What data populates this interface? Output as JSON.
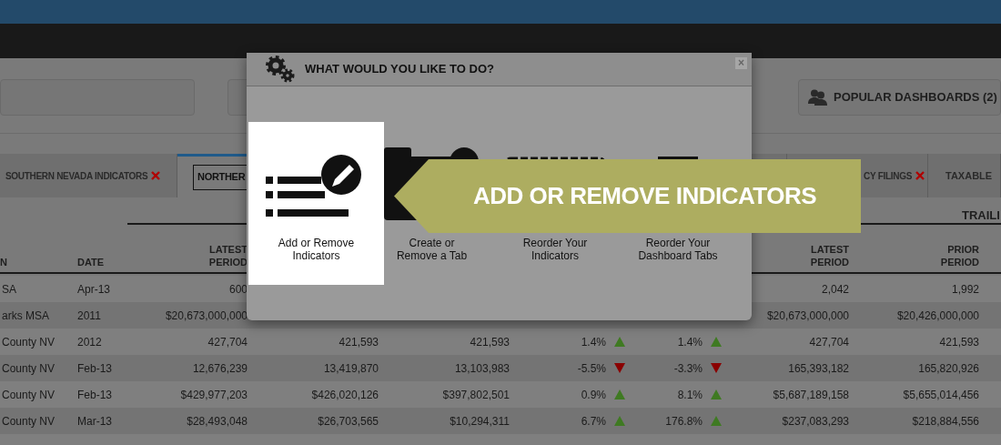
{
  "toolbar": {
    "popular_button": "POPULAR DASHBOARDS (2)"
  },
  "tabs": [
    {
      "label": "SOUTHERN NEVADA INDICATORS",
      "selected": false,
      "closable": true
    },
    {
      "label": "NORTHER",
      "selected": true,
      "closable": false
    },
    {
      "label": "CY FILINGS",
      "selected": false,
      "closable": true
    },
    {
      "label": "TAXABLE",
      "selected": false,
      "closable": false
    }
  ],
  "table": {
    "group_header": "TRAILI",
    "columns": [
      {
        "label": "N"
      },
      {
        "label": "DATE"
      },
      {
        "label": "LATEST\nPERIOD"
      },
      {
        "label": "LATEST\nPERIOD"
      },
      {
        "label": "PRIOR\nPERIOD"
      }
    ],
    "rows": [
      {
        "name": "SA",
        "date": "Apr-13",
        "latest_period": "600",
        "latest_period_2": "2,042",
        "prior_period": "1,992"
      },
      {
        "name": "arks MSA",
        "date": "2011",
        "latest_period": "$20,673,000,000",
        "latest_period_2": "$20,673,000,000",
        "prior_period": "$20,426,000,000"
      },
      {
        "name": "County NV",
        "date": "2012",
        "latest_period": "427,704",
        "column_4": "421,593",
        "column_5": "421,593",
        "change_1": {
          "value": "1.4%",
          "rising": true
        },
        "change_2": {
          "value": "1.4%",
          "rising": true
        },
        "latest_period_2": "427,704",
        "prior_period": "421,593"
      },
      {
        "name": "County NV",
        "date": "Feb-13",
        "latest_period": "12,676,239",
        "column_4": "13,419,870",
        "column_5": "13,103,983",
        "change_1": {
          "value": "-5.5%",
          "rising": false
        },
        "change_2": {
          "value": "-3.3%",
          "rising": false
        },
        "latest_period_2": "165,393,182",
        "prior_period": "165,820,926"
      },
      {
        "name": "County NV",
        "date": "Feb-13",
        "latest_period": "$429,977,203",
        "column_4": "$426,020,126",
        "column_5": "$397,802,501",
        "change_1": {
          "value": "0.9%",
          "rising": true
        },
        "change_2": {
          "value": "8.1%",
          "rising": true
        },
        "latest_period_2": "$5,687,189,158",
        "prior_period": "$5,655,014,456"
      },
      {
        "name": "County NV",
        "date": "Mar-13",
        "latest_period": "$28,493,048",
        "column_4": "$26,703,565",
        "column_5": "$10,294,311",
        "change_1": {
          "value": "6.7%",
          "rising": true
        },
        "change_2": {
          "value": "176.8%",
          "rising": true
        },
        "latest_period_2": "$237,083,293",
        "prior_period": "$218,884,556"
      }
    ]
  },
  "dialog": {
    "title": "WHAT WOULD YOU LIKE TO DO?",
    "close": "×",
    "options": [
      {
        "kind": "indicators",
        "label": "Add or Remove\nIndicators",
        "selected": true
      },
      {
        "kind": "tab",
        "label": "Create or\nRemove a Tab",
        "selected": false
      },
      {
        "kind": "reorder-indicators",
        "label": "Reorder Your\nIndicators",
        "selected": false
      },
      {
        "kind": "reorder-tabs",
        "label": "Reorder Your\nDashboard Tabs",
        "selected": false
      }
    ]
  },
  "callout": {
    "text": "ADD OR REMOVE INDICATORS"
  }
}
